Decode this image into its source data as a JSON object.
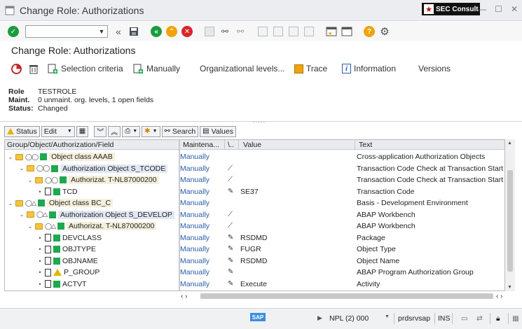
{
  "window": {
    "title": "Change Role: Authorizations",
    "badge": "SEC Consult"
  },
  "page_title": "Change Role: Authorizations",
  "app_toolbar": {
    "selection_criteria": "Selection criteria",
    "manually": "Manually",
    "org_levels": "Organizational levels...",
    "trace": "Trace",
    "information": "Information",
    "versions": "Versions"
  },
  "header": {
    "role_label": "Role",
    "role_value": "TESTROLE",
    "maint_label": "Maint.",
    "maint_value": "0 unmaint. org. levels, 1 open fields",
    "status_label": "Status:",
    "status_value": "Changed"
  },
  "alv_toolbar": {
    "status": "Status",
    "edit": "Edit",
    "search": "Search",
    "values": "Values"
  },
  "columns": {
    "tree": "Group/Object/Authorization/Field",
    "maint": "Maintena...",
    "flag": "\\..",
    "value": "Value",
    "text": "Text"
  },
  "rows": [
    {
      "name": "Object class AAAB",
      "maint": "Manually",
      "value": "",
      "text": "Cross-application Authorization Objects"
    },
    {
      "name": "Authorization Object S_TCODE",
      "maint": "Manually",
      "value": "",
      "text": "Transaction Code Check at Transaction Start"
    },
    {
      "name": "Authorizat. T-NL87000200",
      "maint": "Manually",
      "value": "",
      "text": "Transaction Code Check at Transaction Start"
    },
    {
      "name": "TCD",
      "maint": "Manually",
      "value": "SE37",
      "text": "Transaction Code"
    },
    {
      "name": "Object class BC_C",
      "maint": "Manually",
      "value": "",
      "text": "Basis - Development Environment"
    },
    {
      "name": "Authorization Object S_DEVELOP",
      "maint": "Manually",
      "value": "",
      "text": "ABAP Workbench"
    },
    {
      "name": "Authorizat. T-NL87000200",
      "maint": "Manually",
      "value": "",
      "text": "ABAP Workbench"
    },
    {
      "name": "DEVCLASS",
      "maint": "Manually",
      "value": "RSDMD",
      "text": "Package"
    },
    {
      "name": "OBJTYPE",
      "maint": "Manually",
      "value": "FUGR",
      "text": "Object Type"
    },
    {
      "name": "OBJNAME",
      "maint": "Manually",
      "value": "RSDMD",
      "text": "Object Name"
    },
    {
      "name": "P_GROUP",
      "maint": "Manually",
      "value": "",
      "text": "ABAP Program Authorization Group"
    },
    {
      "name": "ACTVT",
      "maint": "Manually",
      "value": "Execute",
      "text": "Activity"
    }
  ],
  "statusbar": {
    "sap": "SAP",
    "system": "NPL (2) 000",
    "server": "prdsrvsap",
    "mode": "INS"
  },
  "colors": {
    "folder": "#f4c542",
    "green_status": "#1fa84f",
    "yellow_status": "#e3b400",
    "link_blue": "#2a5caa"
  }
}
